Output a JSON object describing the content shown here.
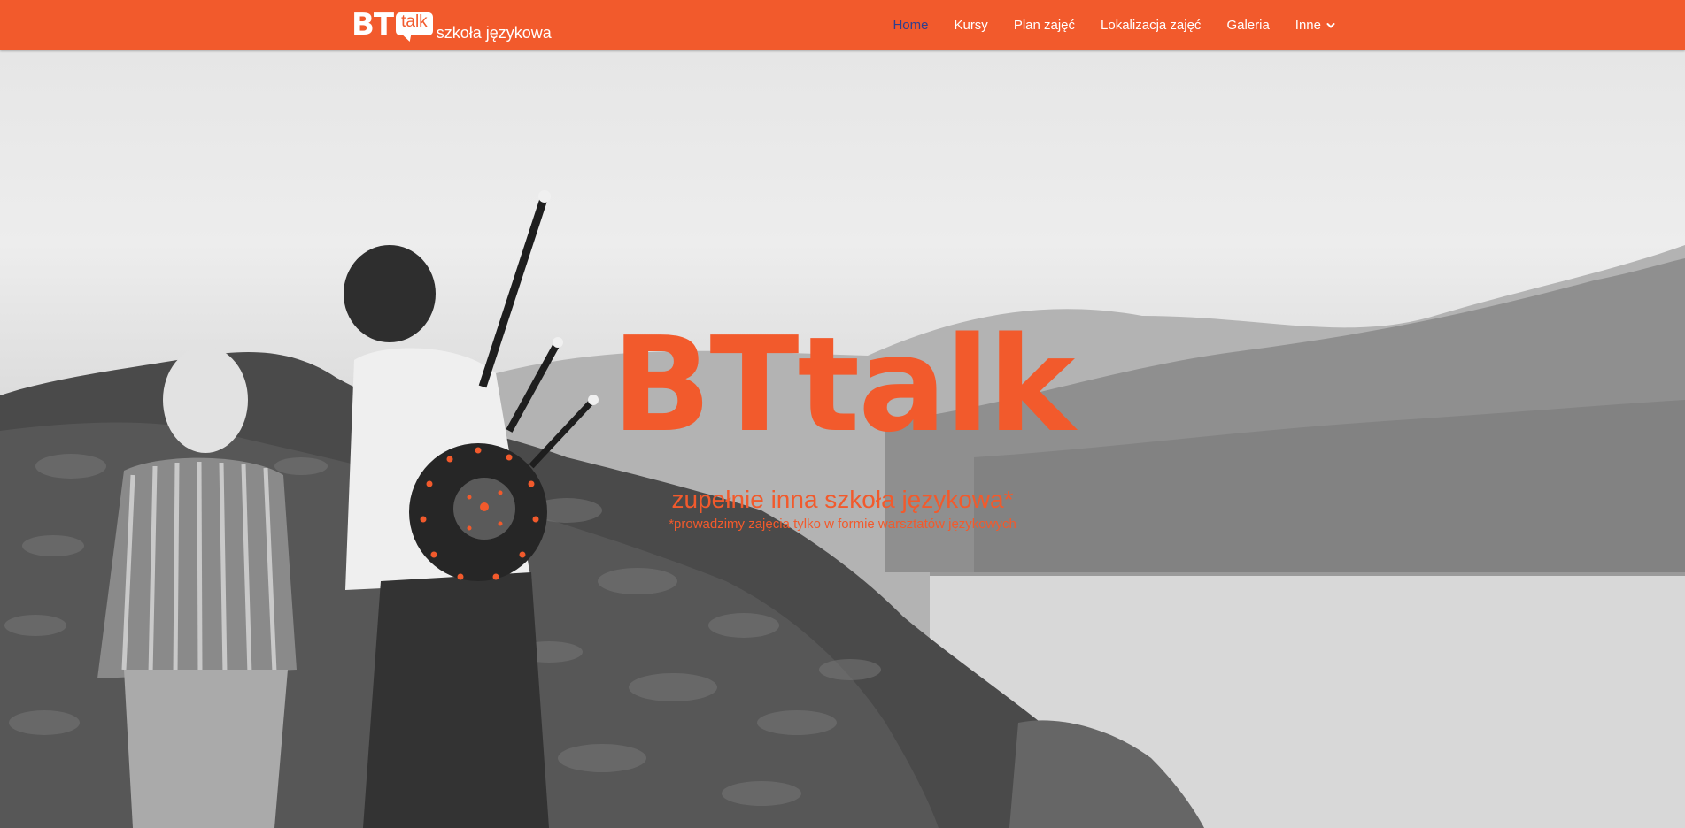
{
  "brand": {
    "bt": "BT",
    "talk": "talk",
    "tagline": "szkoła językowa"
  },
  "nav": {
    "items": [
      {
        "label": "Home",
        "active": true
      },
      {
        "label": "Kursy",
        "active": false
      },
      {
        "label": "Plan zajęć",
        "active": false
      },
      {
        "label": "Lokalizacja zajęć",
        "active": false
      },
      {
        "label": "Galeria",
        "active": false
      },
      {
        "label": "Inne",
        "active": false,
        "icon": "chevron-down-icon"
      }
    ]
  },
  "hero": {
    "title": "BTtalk",
    "subtitle": "zupełnie inna szkoła językowa*",
    "note": "*prowadzimy zajęcia tylko w formie warsztatów językowych"
  },
  "colors": {
    "accent": "#f25a2c",
    "active_nav": "#2e3f8f",
    "nav_text": "#ffffff"
  }
}
